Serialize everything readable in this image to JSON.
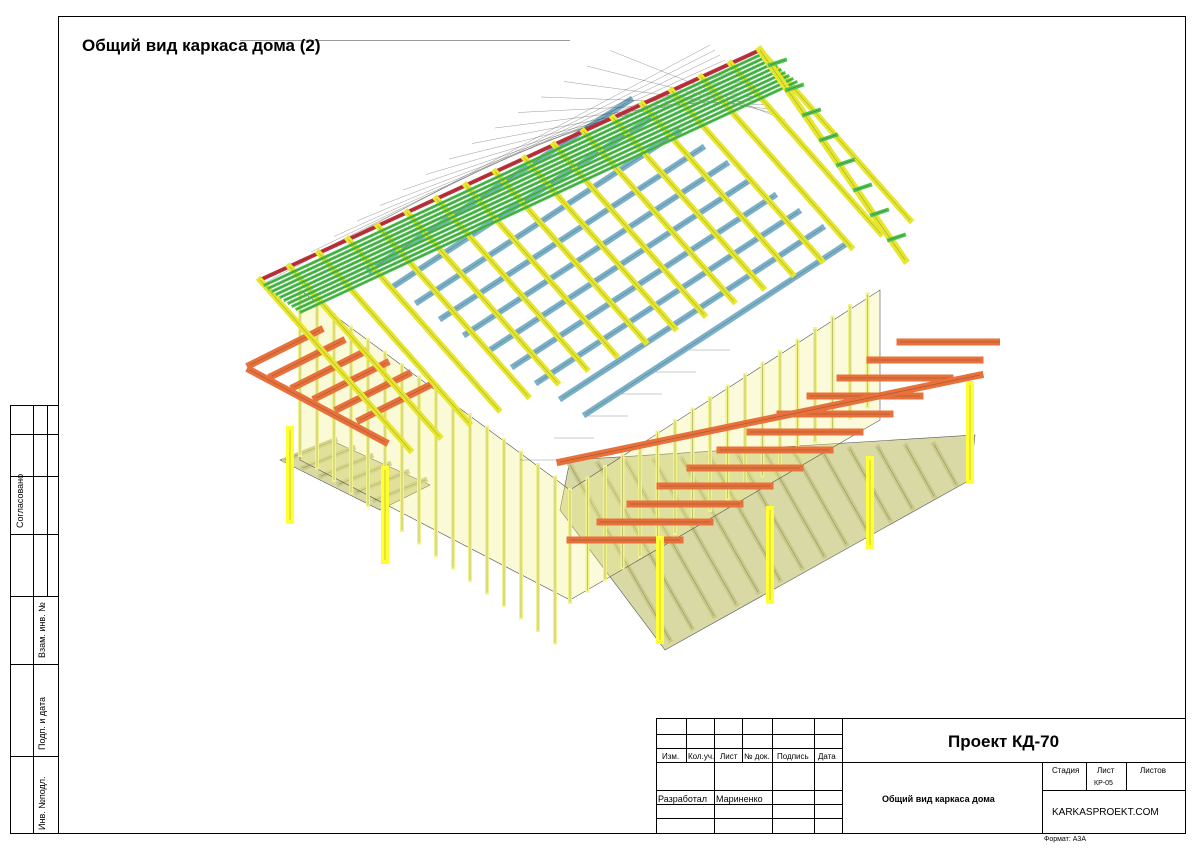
{
  "sheet": {
    "title": "Общий вид каркаса дома (2)"
  },
  "side_stamp": {
    "labels": [
      "Согласовано",
      "Взам. инв. №",
      "Подп. и дата",
      "Инв. №подл."
    ]
  },
  "title_block": {
    "project": "Проект КД-70",
    "columns": [
      "Изм.",
      "Кол.уч.",
      "Лист",
      "№ док.",
      "Подпись",
      "Дата"
    ],
    "developed_label": "Разработал",
    "developer": "Мариненко",
    "drawing_name": "Общий вид каркаса дома",
    "stage_label": "Стадия",
    "sheet_label": "Лист",
    "sheets_label": "Листов",
    "sheet_number": "КР-05",
    "company": "KARKASPROEKT.COM",
    "format": "Формат: А3А"
  },
  "colors": {
    "studs": "#f2f28a",
    "rafters": "#e6e62e",
    "roof_laths": "#4cc24c",
    "porch_rafters": "#e8703a",
    "joists": "#7ab0c8",
    "ridge": "#c0303a",
    "floor": "#d9d9a6",
    "posts": "#ffff33"
  }
}
